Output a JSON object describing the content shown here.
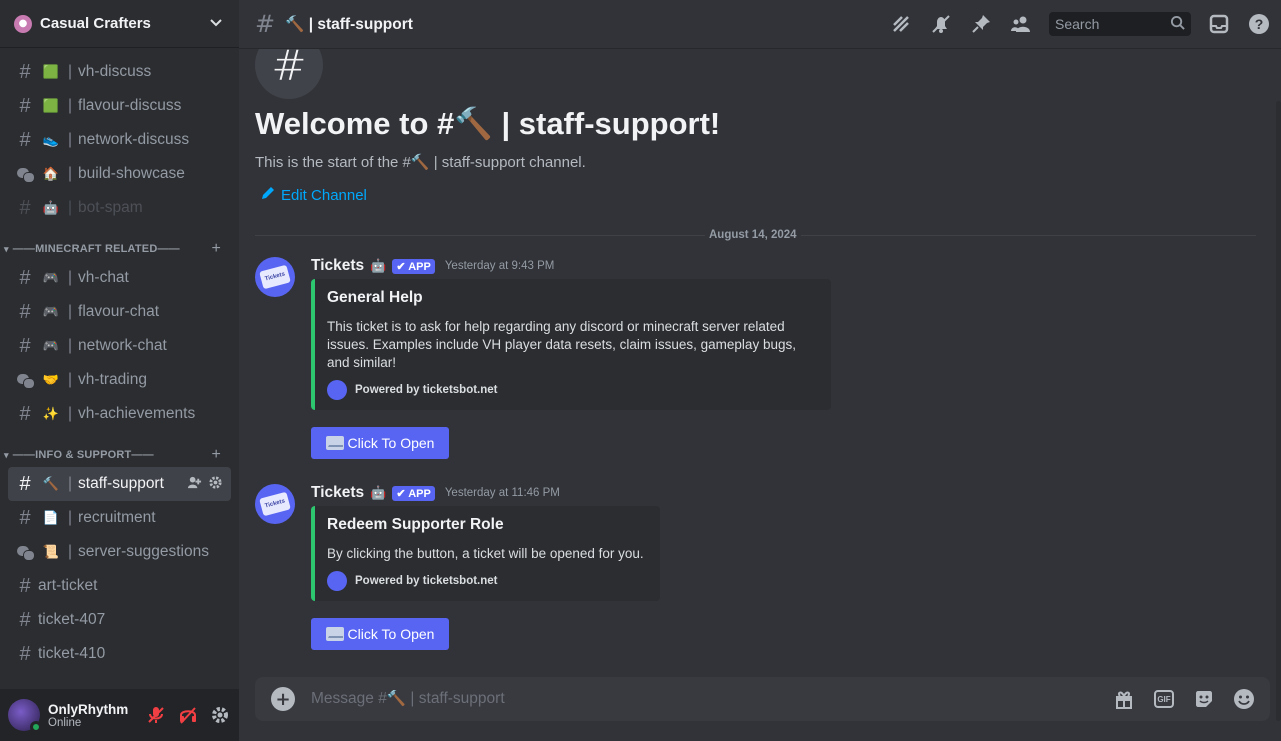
{
  "server": {
    "name": "Casual Crafters"
  },
  "channels_top": [
    {
      "name": "vh-discuss",
      "emoji": "🟩",
      "type": "text"
    },
    {
      "name": "flavour-discuss",
      "emoji": "🟩",
      "type": "text"
    },
    {
      "name": "network-discuss",
      "emoji": "👟",
      "type": "text"
    },
    {
      "name": "build-showcase",
      "emoji": "🏠",
      "type": "forum"
    },
    {
      "name": "bot-spam",
      "emoji": "🤖",
      "type": "text-muted"
    }
  ],
  "categories": {
    "minecraft": "——MINECRAFT RELATED——",
    "info": "——INFO & SUPPORT——"
  },
  "channels_mc": [
    {
      "name": "vh-chat",
      "emoji": "🎮"
    },
    {
      "name": "flavour-chat",
      "emoji": "🎮"
    },
    {
      "name": "network-chat",
      "emoji": "🎮"
    },
    {
      "name": "vh-trading",
      "emoji": "🤝"
    },
    {
      "name": "vh-achievements",
      "emoji": "✨"
    }
  ],
  "channels_info": [
    {
      "name": "staff-support",
      "emoji": "🔨"
    },
    {
      "name": "recruitment",
      "emoji": "📄"
    },
    {
      "name": "server-suggestions",
      "emoji": "📜"
    },
    {
      "name": "art-ticket"
    },
    {
      "name": "ticket-407"
    },
    {
      "name": "ticket-410"
    }
  ],
  "user": {
    "name": "OnlyRhythm",
    "status": "Online"
  },
  "topbar": {
    "title": "🔨 | staff-support",
    "search_placeholder": "Search"
  },
  "welcome": {
    "title": "Welcome to #🔨 | staff-support!",
    "subtitle": "This is the start of the #🔨 | staff-support channel.",
    "edit": "Edit Channel"
  },
  "date_divider": "August 14, 2024",
  "messages": [
    {
      "author": "Tickets",
      "tag": "✔ APP",
      "time": "Yesterday at 9:43 PM",
      "embed_title": "General Help",
      "embed_desc": "This ticket is to ask for help regarding any discord or minecraft server related issues. Examples include VH player data resets, claim issues, gameplay bugs, and similar!",
      "footer": "Powered by ticketsbot.net",
      "button": "Click To Open"
    },
    {
      "author": "Tickets",
      "tag": "✔ APP",
      "time": "Yesterday at 11:46 PM",
      "embed_title": "Redeem Supporter Role",
      "embed_desc": "By clicking the button, a ticket will be opened for you.",
      "footer": "Powered by ticketsbot.net",
      "button": "Click To Open"
    }
  ],
  "composer": {
    "placeholder": "Message #🔨 | staff-support",
    "gif": "GIF"
  },
  "colors": {
    "accent": "#5865f2",
    "embed_border": "#2dc770",
    "online": "#23a55a",
    "link": "#00a8fc"
  }
}
